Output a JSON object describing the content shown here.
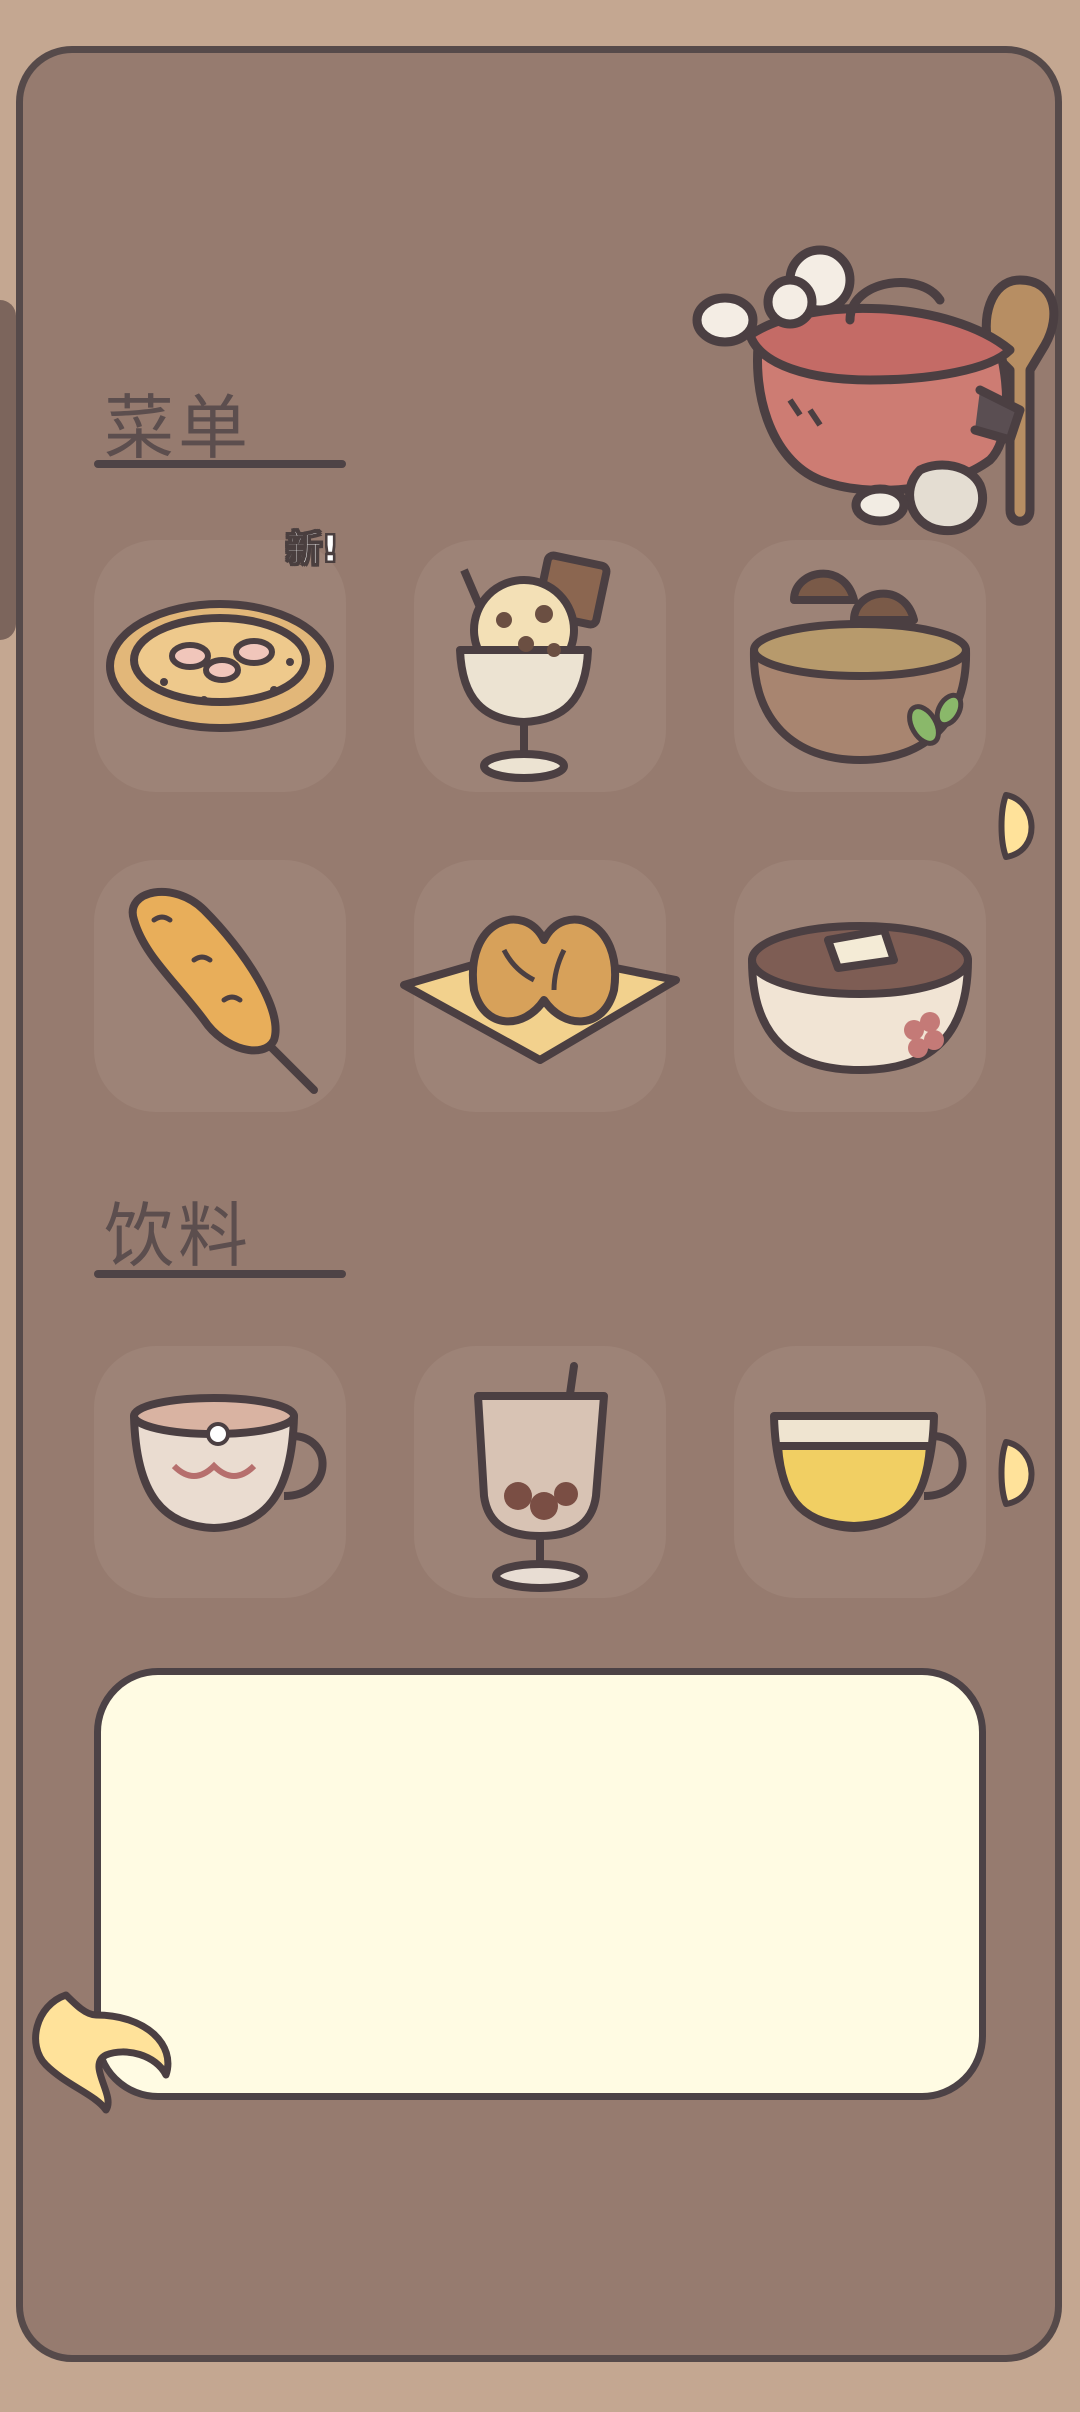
{
  "sections": {
    "menu": {
      "title": "菜单",
      "badge": "新!",
      "items": [
        {
          "icon": "pizza-icon"
        },
        {
          "icon": "ice-cream-sundae-icon"
        },
        {
          "icon": "mushroom-soup-icon"
        },
        {
          "icon": "corn-skewer-icon"
        },
        {
          "icon": "pretzel-pastry-icon"
        },
        {
          "icon": "tofu-bowl-icon"
        }
      ]
    },
    "drinks": {
      "title": "饮料",
      "items": [
        {
          "icon": "flower-tea-icon"
        },
        {
          "icon": "bean-drink-glass-icon"
        },
        {
          "icon": "honey-tea-icon"
        }
      ]
    }
  },
  "decorations": {
    "header": "cooking-pot-icon"
  },
  "controls": {
    "next": "next-arrow-icon",
    "back": "back-arrow-icon"
  },
  "colors": {
    "background": "#c4a791",
    "panel": "#967b6f",
    "tile": "#9d8377",
    "textbox": "#fffbe3",
    "outline": "#4c4246",
    "accent": "#ffe29a"
  }
}
